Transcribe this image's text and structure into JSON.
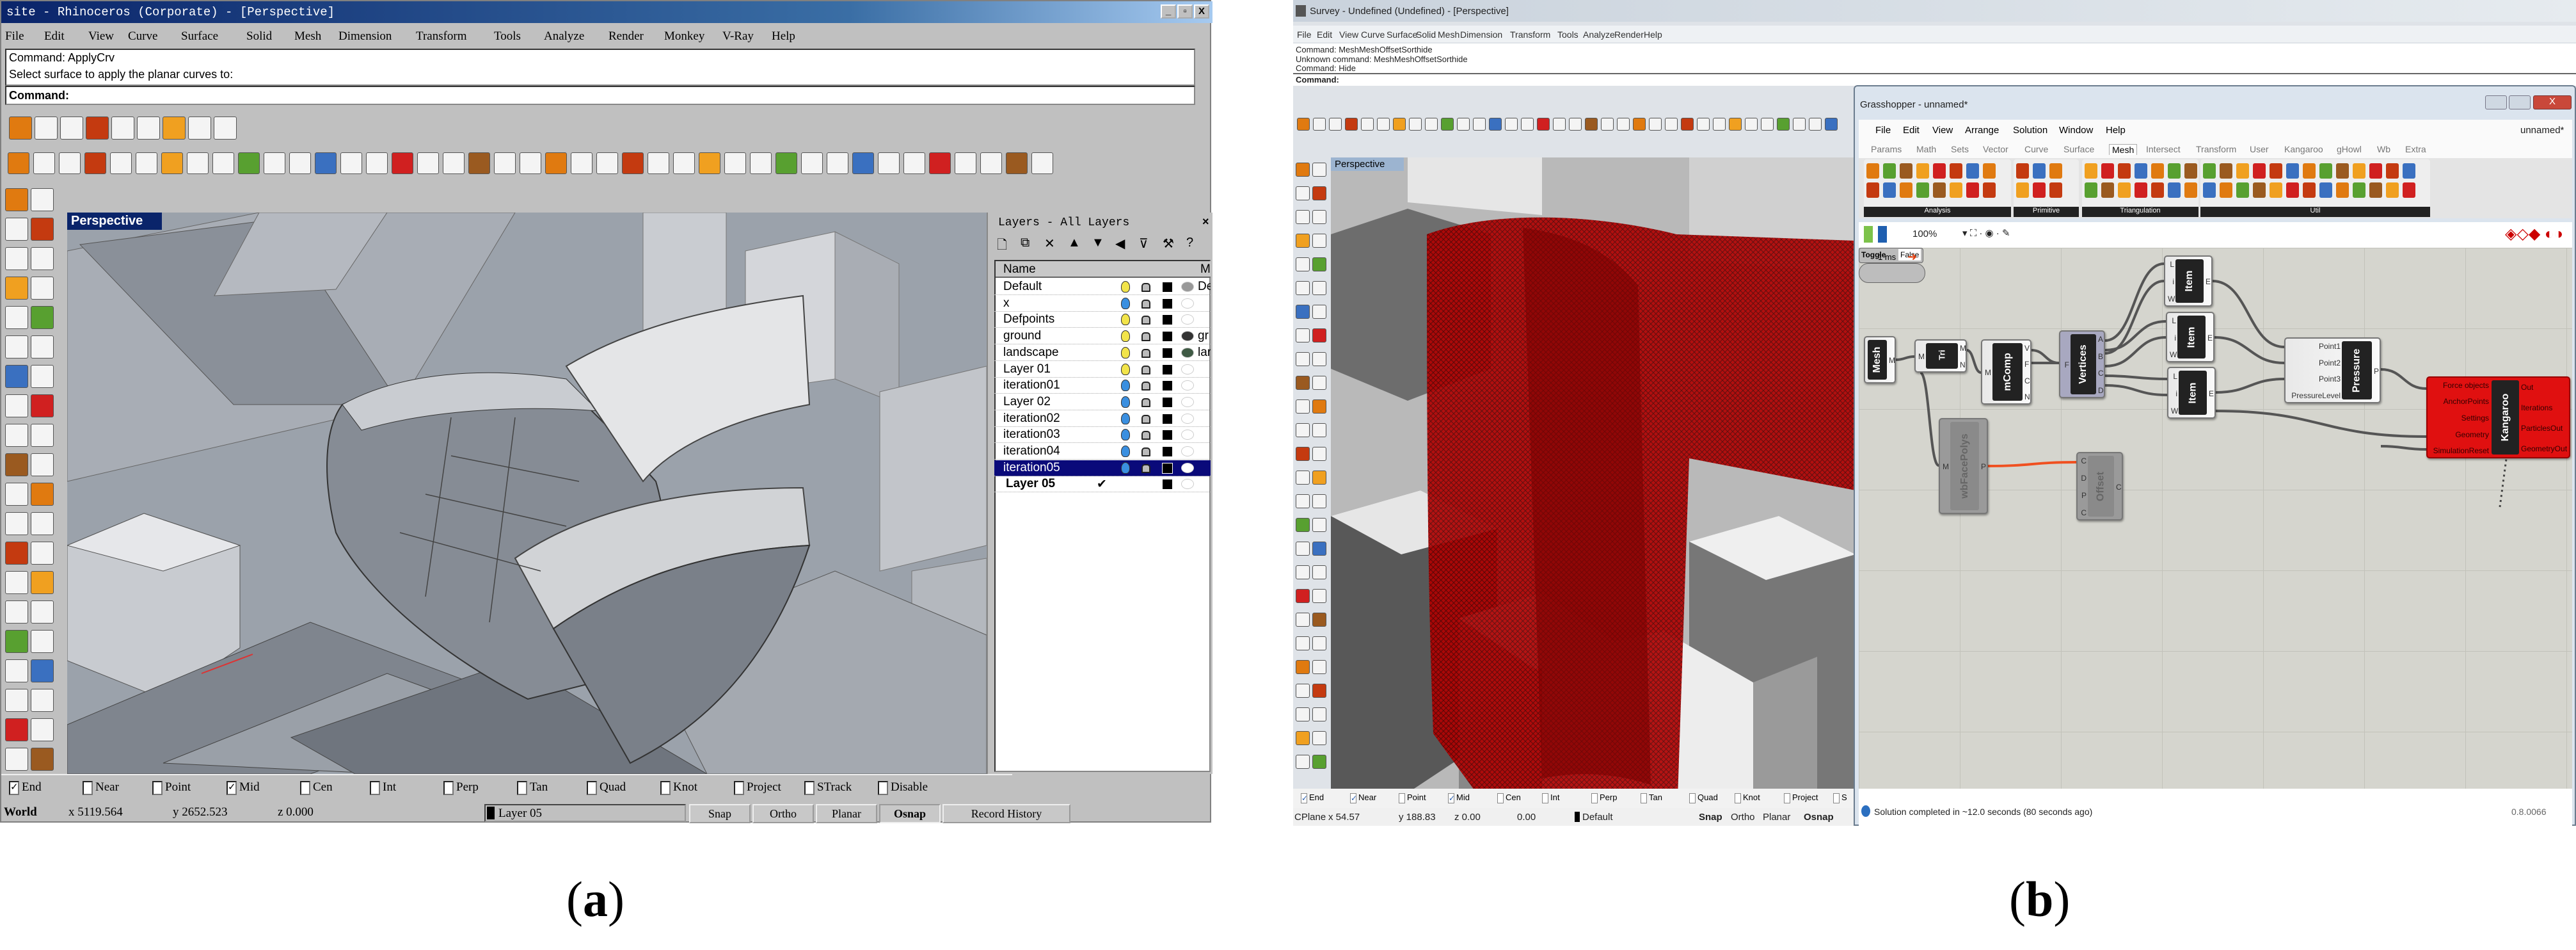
{
  "panel_a": {
    "caption_open": "(",
    "caption_letter": "a",
    "caption_close": ")",
    "title": "site - Rhinoceros (Corporate) - [Perspective]",
    "window_buttons": [
      "_",
      "▫",
      "X"
    ],
    "menu": [
      "File",
      "Edit",
      "View",
      "Curve",
      "Surface",
      "Solid",
      "Mesh",
      "Dimension",
      "Transform",
      "Tools",
      "Analyze",
      "Render",
      "Monkey",
      "V-Ray",
      "Help"
    ],
    "command_history": [
      "Command: ApplyCrv",
      "Select surface to apply the planar curves to:"
    ],
    "command_prompt": "Command:",
    "viewport_label": "Perspective",
    "layers": {
      "title": "Layers - All Layers",
      "toolbar_icons": [
        "new-layer-icon",
        "new-sublayer-icon",
        "delete-icon",
        "move-up-icon",
        "move-down-icon",
        "move-left-icon",
        "filter-icon",
        "tools-icon",
        "help-icon"
      ],
      "toolbar_glyphs": [
        "🗋",
        "⧉",
        "✕",
        "▲",
        "▼",
        "◀",
        "⊽",
        "⚒",
        "?"
      ],
      "headers": [
        "Name",
        "",
        "",
        "",
        "",
        "",
        "M"
      ],
      "rows": [
        {
          "name": "Default",
          "bulb": "#f2e44a",
          "material": "#999999",
          "mat_name": "De"
        },
        {
          "name": "x",
          "bulb": "#3a8fe0",
          "material": "#ffffff",
          "mat_name": ""
        },
        {
          "name": "Defpoints",
          "bulb": "#f2e44a",
          "material": "#ffffff",
          "mat_name": ""
        },
        {
          "name": "ground",
          "bulb": "#f2e44a",
          "material": "#333333",
          "mat_name": "gr"
        },
        {
          "name": "landscape",
          "bulb": "#f2e44a",
          "material": "#3f5a44",
          "mat_name": "lar"
        },
        {
          "name": "Layer 01",
          "bulb": "#f2e44a",
          "material": "#ffffff",
          "mat_name": ""
        },
        {
          "name": "iteration01",
          "bulb": "#3a8fe0",
          "material": "#ffffff",
          "mat_name": ""
        },
        {
          "name": "Layer 02",
          "bulb": "#3a8fe0",
          "material": "#ffffff",
          "mat_name": ""
        },
        {
          "name": "iteration02",
          "bulb": "#3a8fe0",
          "material": "#ffffff",
          "mat_name": ""
        },
        {
          "name": "iteration03",
          "bulb": "#3a8fe0",
          "material": "#ffffff",
          "mat_name": ""
        },
        {
          "name": "iteration04",
          "bulb": "#3a8fe0",
          "material": "#ffffff",
          "mat_name": ""
        },
        {
          "name": "iteration05",
          "bulb": "#3a8fe0",
          "material": "#ffffff",
          "mat_name": "",
          "selected": true
        },
        {
          "name": "Layer 05",
          "current": true,
          "check": "✔",
          "material": "#ffffff",
          "mat_name": ""
        }
      ]
    },
    "osnap": [
      {
        "label": "End",
        "checked": true
      },
      {
        "label": "Near",
        "checked": false
      },
      {
        "label": "Point",
        "checked": false
      },
      {
        "label": "Mid",
        "checked": true
      },
      {
        "label": "Cen",
        "checked": false
      },
      {
        "label": "Int",
        "checked": false
      },
      {
        "label": "Perp",
        "checked": false
      },
      {
        "label": "Tan",
        "checked": false
      },
      {
        "label": "Quad",
        "checked": false
      },
      {
        "label": "Knot",
        "checked": false
      },
      {
        "label": "Project",
        "checked": false
      },
      {
        "label": "STrack",
        "checked": false
      },
      {
        "label": "Disable",
        "checked": false
      }
    ],
    "status": {
      "cplane": "World",
      "x": "x 5119.564",
      "y": "y 2652.523",
      "z": "z 0.000",
      "layer": "Layer 05",
      "buttons": [
        "Snap",
        "Ortho",
        "Planar",
        "Osnap",
        "Record History"
      ]
    }
  },
  "panel_b": {
    "caption_open": "(",
    "caption_letter": "b",
    "caption_close": ")",
    "title": "Survey - Undefined (Undefined) - [Perspective]",
    "menu": [
      "File",
      "Edit",
      "View",
      "Curve",
      "Surface",
      "Solid",
      "Mesh",
      "Dimension",
      "Transform",
      "Tools",
      "Analyze",
      "Render",
      "Help"
    ],
    "command_history": [
      "Command: MeshMeshOffsetSorthide",
      "Unknown command: MeshMeshOffsetSorthide",
      "Command: Hide"
    ],
    "command_prompt": "Command:",
    "viewport_label": "Perspective",
    "mesh_color": "#c00000",
    "osnap": [
      {
        "label": "End",
        "checked": true
      },
      {
        "label": "Near",
        "checked": true
      },
      {
        "label": "Point",
        "checked": false
      },
      {
        "label": "Mid",
        "checked": true
      },
      {
        "label": "Cen",
        "checked": false
      },
      {
        "label": "Int",
        "checked": false
      },
      {
        "label": "Perp",
        "checked": false
      },
      {
        "label": "Tan",
        "checked": false
      },
      {
        "label": "Quad",
        "checked": false
      },
      {
        "label": "Knot",
        "checked": false
      },
      {
        "label": "Project",
        "checked": false
      },
      {
        "label": "S",
        "checked": false
      }
    ],
    "status": {
      "cplane": "CPlane",
      "x": "x 54.57",
      "y": "y 188.83",
      "z": "z 0.00",
      "extra": "0.00",
      "layer": "Default",
      "buttons": [
        "Snap",
        "Ortho",
        "Planar",
        "Osnap"
      ]
    },
    "grasshopper": {
      "title": "Grasshopper - unnamed*",
      "doc_name": "unnamed*",
      "menu": [
        "File",
        "Edit",
        "View",
        "Arrange",
        "Solution",
        "Window",
        "Help"
      ],
      "tabs": [
        "Params",
        "Math",
        "Sets",
        "Vector",
        "Curve",
        "Surface",
        "Mesh",
        "Intersect",
        "Transform",
        "User",
        "Kangaroo",
        "gHowl",
        "Wb",
        "Extra"
      ],
      "active_tab": "Mesh",
      "groups": [
        "Analysis",
        "Primitive",
        "Triangulation",
        "Util"
      ],
      "zoom": "100%",
      "nodes": {
        "mesh": {
          "name": "Mesh",
          "outputs": [
            "M"
          ],
          "inputs": []
        },
        "tri": {
          "name": "Tri",
          "inputs": [
            "M"
          ],
          "outputs": [
            "M",
            "N"
          ]
        },
        "mcomp": {
          "name": "mComp",
          "inputs": [
            "M"
          ],
          "outputs": [
            "V",
            "F",
            "C",
            "N"
          ]
        },
        "vertices": {
          "name": "Vertices",
          "inputs": [
            "F"
          ],
          "outputs": [
            "A",
            "B",
            "C",
            "D"
          ]
        },
        "item1": {
          "name": "Item",
          "inputs": [
            "L",
            "i",
            "W"
          ],
          "outputs": [
            "E"
          ]
        },
        "item2": {
          "name": "Item",
          "inputs": [
            "L",
            "i",
            "W"
          ],
          "outputs": [
            "E"
          ]
        },
        "item3": {
          "name": "Item",
          "inputs": [
            "L",
            "i",
            "W"
          ],
          "outputs": [
            "E"
          ]
        },
        "pressure": {
          "name": "Pressure",
          "inputs": [
            "Point1",
            "Point2",
            "Point3",
            "PressureLevel"
          ],
          "outputs": [
            "P"
          ]
        },
        "kangaroo": {
          "name": "Kangaroo",
          "inputs": [
            "Force objects",
            "AnchorPoints",
            "Settings",
            "Geometry",
            "SimulationReset"
          ],
          "outputs": [
            "Out",
            "Iterations",
            "ParticlesOut",
            "GeometryOut"
          ]
        },
        "wbfacepolys": {
          "name": "wbFacePolys",
          "inputs": [
            "M"
          ],
          "outputs": [
            "P"
          ]
        },
        "offset": {
          "name": "Offset",
          "inputs": [
            "C",
            "D",
            "P",
            "C"
          ],
          "outputs": [
            "C"
          ]
        }
      },
      "toggle": {
        "label": "Toggle",
        "value": "False"
      },
      "timer": {
        "label": "1 ms"
      },
      "kangaroo_color": "#e01010",
      "status": "Solution completed in ~12.0 seconds (80 seconds ago)",
      "version": "0.8.0066"
    }
  }
}
